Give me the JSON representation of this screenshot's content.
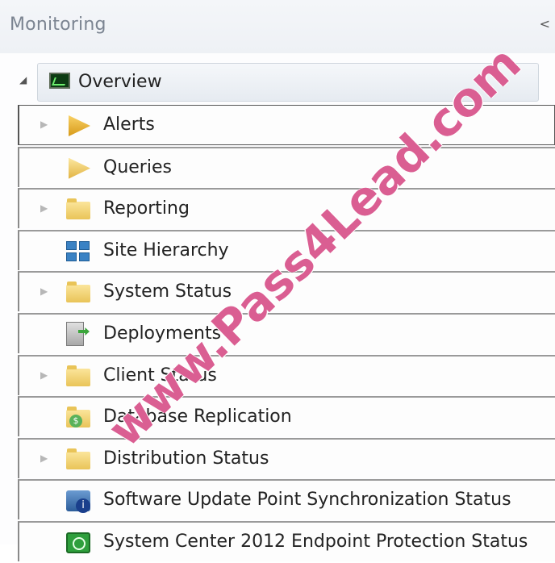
{
  "header": {
    "title": "Monitoring",
    "collapse_glyph": "<"
  },
  "overview": {
    "label": "Overview",
    "icon": "overview-monitor-icon"
  },
  "items": [
    {
      "label": "Alerts",
      "expandable": true,
      "icon": "alerts-icon"
    },
    {
      "label": "Queries",
      "expandable": false,
      "icon": "queries-icon"
    },
    {
      "label": "Reporting",
      "expandable": true,
      "icon": "folder-icon"
    },
    {
      "label": "Site Hierarchy",
      "expandable": false,
      "icon": "site-hierarchy-icon"
    },
    {
      "label": "System Status",
      "expandable": true,
      "icon": "folder-icon"
    },
    {
      "label": "Deployments",
      "expandable": false,
      "icon": "deployments-icon"
    },
    {
      "label": "Client Status",
      "expandable": true,
      "icon": "folder-icon"
    },
    {
      "label": "Database Replication",
      "expandable": false,
      "icon": "database-replication-icon"
    },
    {
      "label": "Distribution Status",
      "expandable": true,
      "icon": "folder-icon"
    },
    {
      "label": "Software Update Point Synchronization Status",
      "expandable": false,
      "icon": "software-update-icon"
    },
    {
      "label": "System Center 2012 Endpoint Protection Status",
      "expandable": false,
      "icon": "endpoint-protection-icon"
    }
  ],
  "watermark": "www.Pass4Lead.com"
}
